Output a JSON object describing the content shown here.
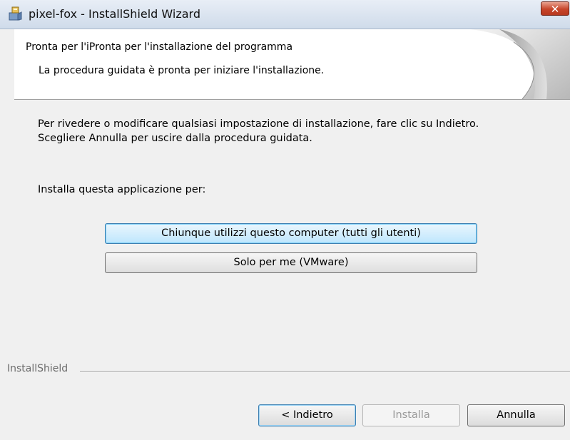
{
  "window": {
    "title": "pixel-fox - InstallShield Wizard",
    "close_label": "✕"
  },
  "header": {
    "title": "Pronta per l'iPronta per l'installazione del programma",
    "subtitle": "La procedura guidata è pronta per iniziare l'installazione."
  },
  "body": {
    "instructions_line1": "Per rivedere o modificare qualsiasi impostazione di installazione, fare clic su Indietro.",
    "instructions_line2": "Scegliere Annulla per uscire dalla procedura guidata.",
    "install_for_label": "Installa questa applicazione per:",
    "options": [
      {
        "label": "Chiunque utilizzi questo computer (tutti gli utenti)",
        "selected": true
      },
      {
        "label": "Solo per me (VMware)",
        "selected": false
      }
    ]
  },
  "footer": {
    "brand": "InstallShield",
    "back_label": "< Indietro",
    "install_label": "Installa",
    "install_enabled": false,
    "cancel_label": "Annulla"
  },
  "icons": {
    "app": "installer-icon",
    "close": "close-icon",
    "banner": "page-curl-graphic"
  },
  "colors": {
    "close_button": "#c7452a",
    "selected_option": "#bee6fd",
    "focus_border": "#3c7fb1"
  }
}
